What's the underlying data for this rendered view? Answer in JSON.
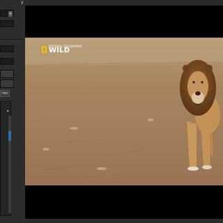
{
  "panel": {
    "top_label": "y",
    "tab_label": "ries",
    "dropdown_arrow": "▾",
    "stepper_arrow": "▴"
  },
  "video": {
    "logo": {
      "small_text": "NATIONAL GEOGRAPHIC",
      "brand_text": "WILD",
      "accent": "#f2c200"
    },
    "scene": "lion walking on dry savanna"
  },
  "colors": {
    "panel_bg": "#2d2d2d",
    "viewer_bg": "#000000",
    "selection_accent": "#2f6ea8"
  }
}
